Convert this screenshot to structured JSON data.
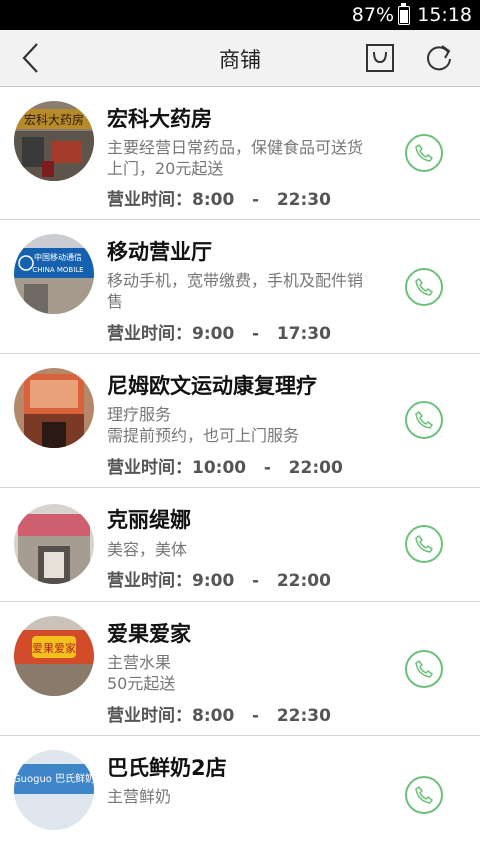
{
  "status_bar": {
    "battery": "87%",
    "time": "15:18"
  },
  "header": {
    "title": "商铺",
    "back_icon": "chevron-left-icon",
    "cart_icon": "shopping-bag-icon",
    "refresh_icon": "refresh-icon"
  },
  "colors": {
    "accent_green": "#6cc07a",
    "header_bg": "#f2f2f2"
  },
  "shops": [
    {
      "name": "宏科大药房",
      "desc": "主要经营日常药品，保健食品可送货上门，20元起送",
      "hours": "营业时间：8:00   -   22:30",
      "sign_text": "宏科大药房"
    },
    {
      "name": "移动营业厅",
      "desc": "移动手机，宽带缴费，手机及配件销售",
      "hours": "营业时间：9:00   -   17:30",
      "sign_text": "中国移动通信 CHINA MOBILE"
    },
    {
      "name": "尼姆欧文运动康复理疗",
      "desc": "理疗服务\n需提前预约，也可上门服务",
      "hours": "营业时间：10:00   -   22:00",
      "sign_text": ""
    },
    {
      "name": "克丽缇娜",
      "desc": "美容，美体",
      "hours": "营业时间：9:00   -   22:00",
      "sign_text": ""
    },
    {
      "name": "爱果爱家",
      "desc": "主营水果\n50元起送",
      "hours": "营业时间：8:00   -   22:30",
      "sign_text": "爱果爱家"
    },
    {
      "name": "巴氏鲜奶2店",
      "desc": "主营鲜奶",
      "hours": "",
      "sign_text": "Guoguo 巴氏鲜奶"
    }
  ]
}
